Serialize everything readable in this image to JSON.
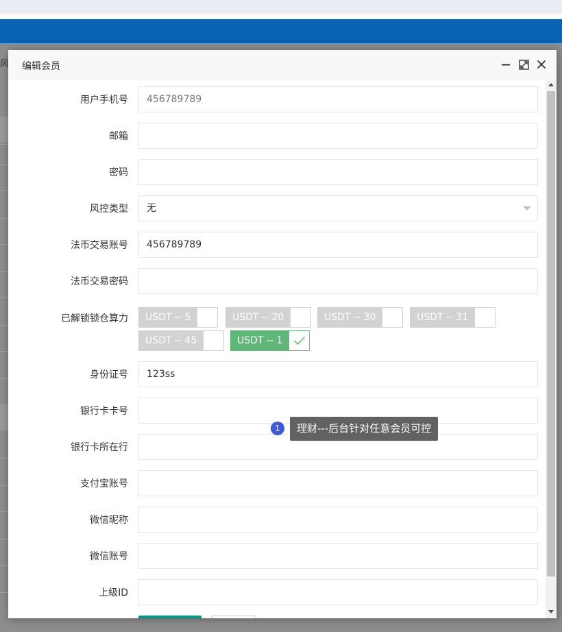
{
  "background": {
    "partial_text": "风控"
  },
  "modal": {
    "title": "编辑会员",
    "fields": {
      "phone": {
        "label": "用户手机号",
        "value": "456789789"
      },
      "email": {
        "label": "邮箱",
        "value": ""
      },
      "password": {
        "label": "密码",
        "value": ""
      },
      "risk_type": {
        "label": "风控类型",
        "value": "无"
      },
      "fiat_account": {
        "label": "法币交易账号",
        "value": "456789789"
      },
      "fiat_password": {
        "label": "法币交易密码",
        "value": ""
      },
      "unlocked_power": {
        "label": "已解锁锁仓算力",
        "options": [
          {
            "label": "USDT -- 5",
            "checked": false
          },
          {
            "label": "USDT -- 20",
            "checked": false
          },
          {
            "label": "USDT -- 30",
            "checked": false
          },
          {
            "label": "USDT -- 31",
            "checked": false
          },
          {
            "label": "USDT -- 45",
            "checked": false
          },
          {
            "label": "USDT -- 1",
            "checked": true
          }
        ]
      },
      "id_number": {
        "label": "身份证号",
        "value": "123ss"
      },
      "bank_card": {
        "label": "银行卡卡号",
        "value": ""
      },
      "bank_name": {
        "label": "银行卡所在行",
        "value": ""
      },
      "alipay": {
        "label": "支付宝账号",
        "value": ""
      },
      "wechat_nick": {
        "label": "微信昵称",
        "value": ""
      },
      "wechat_account": {
        "label": "微信账号",
        "value": ""
      },
      "parent_id": {
        "label": "上级ID",
        "value": ""
      }
    },
    "tooltip": {
      "badge": "1",
      "text": "理财---后台针对任意会员可控"
    }
  },
  "colors": {
    "primary_button": "#009688",
    "checked": "#5fb878",
    "unchecked": "#d2d2d2",
    "header_bar": "#0b63b6"
  }
}
